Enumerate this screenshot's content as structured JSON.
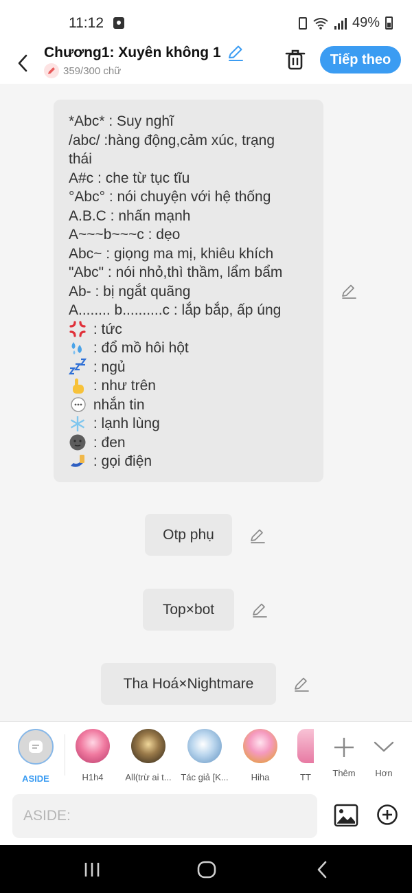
{
  "status_bar": {
    "time": "11:12",
    "battery_percent": "49%"
  },
  "header": {
    "title": "Chương1: Xuyên không 1",
    "word_count": "359/300 chữ",
    "next_button": "Tiếp theo"
  },
  "legend_bubble": {
    "lines": [
      "*Abc* : Suy nghĩ",
      "/abc/ :hàng động,cảm xúc, trạng",
      "thái",
      "A#c : che từ tục tĩu",
      "°Abc° : nói chuyện với hệ thống",
      "A.B.C : nhấn mạnh",
      "A~~~b~~~c : dẹo",
      "Abc~ : giọng ma mị, khiêu khích",
      "\"Abc\" : nói nhỏ,thì thầm, lẩm bẩm",
      "Ab- : bị ngắt quãng",
      "A........ b..........c : lắp bắp, ấp úng"
    ],
    "emoji_lines": [
      {
        "icon": "anger-icon",
        "text": " : tức"
      },
      {
        "icon": "sweat-droplets-icon",
        "text": " : đổ mồ hôi hột"
      },
      {
        "icon": "zzz-icon",
        "text": " : ngủ"
      },
      {
        "icon": "pointing-up-hand-icon",
        "text": " : như trên"
      },
      {
        "icon": "speech-bubble-icon",
        "text": " nhắn tin"
      },
      {
        "icon": "snowflake-icon",
        "text": " : lạnh lùng"
      },
      {
        "icon": "dark-moon-icon",
        "text": " : đen"
      },
      {
        "icon": "phone-call-icon",
        "text": " : gọi điện"
      }
    ]
  },
  "messages": [
    {
      "text": "Otp phụ"
    },
    {
      "text": "Top×bot"
    },
    {
      "text": "Tha Hoá×Nightmare"
    }
  ],
  "characters": {
    "aside_label": "ASIDE",
    "items": [
      {
        "label": "H1h4"
      },
      {
        "label": "All(trừ ai t..."
      },
      {
        "label": "Tác giả [K..."
      },
      {
        "label": "Hiha"
      },
      {
        "label": "TT"
      }
    ],
    "more_label": "Thêm",
    "collapse_label": "Hơn"
  },
  "input": {
    "placeholder": "ASIDE:"
  },
  "colors": {
    "accent": "#3b9cf2",
    "bubble": "#e9e9e9",
    "background": "#f5f5f5"
  }
}
